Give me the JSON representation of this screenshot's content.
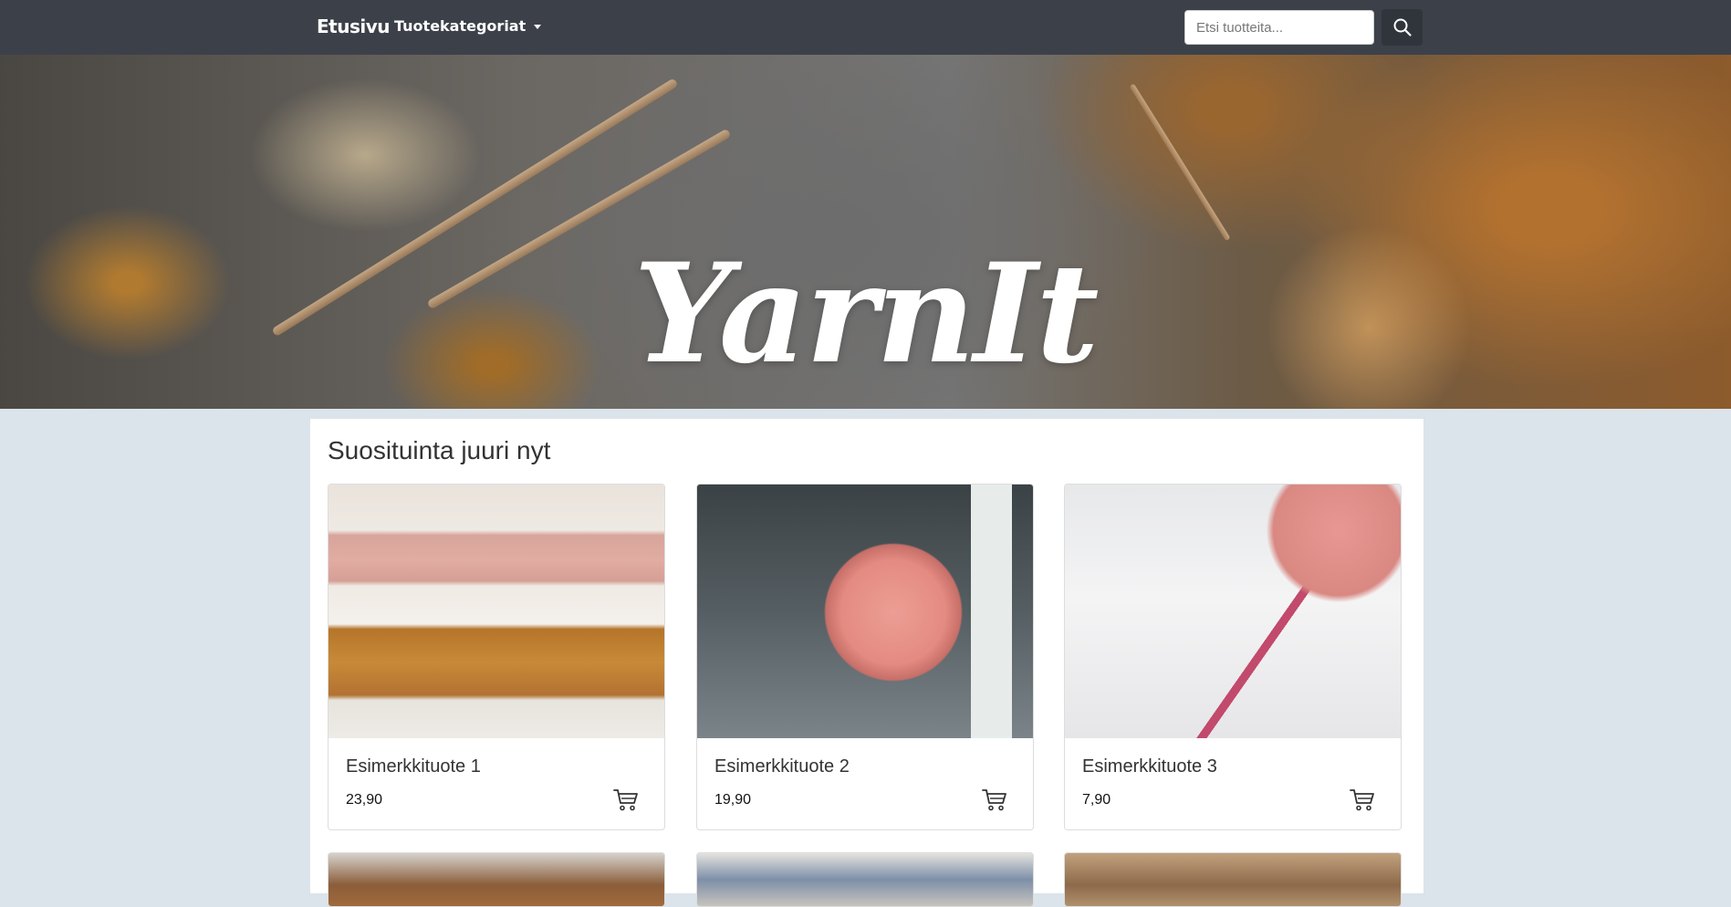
{
  "nav": {
    "brand": "Etusivu",
    "categories_label": "Tuotekategoriat",
    "search_placeholder": "Etsi tuotteita..."
  },
  "hero": {
    "title": "YarnIt"
  },
  "main": {
    "section_title": "Suosituinta juuri nyt",
    "products": [
      {
        "name": "Esimerkkituote 1",
        "price": "23,90"
      },
      {
        "name": "Esimerkkituote 2",
        "price": "19,90"
      },
      {
        "name": "Esimerkkituote 3",
        "price": "7,90"
      }
    ]
  }
}
